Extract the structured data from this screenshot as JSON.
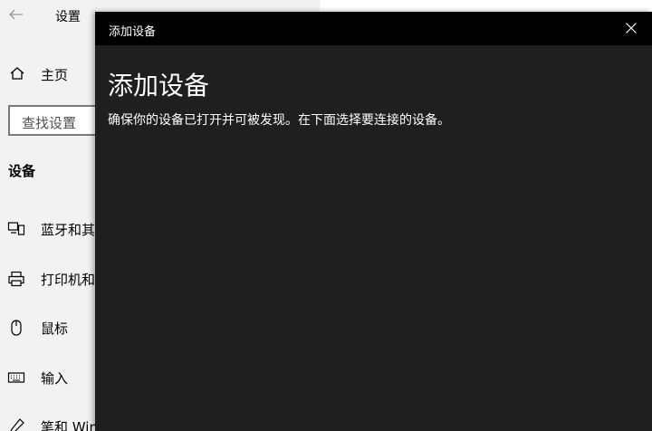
{
  "settings": {
    "title": "设置",
    "home_label": "主页",
    "search_placeholder": "查找设置",
    "section_heading": "设备",
    "nav_items": [
      {
        "label": "蓝牙和其",
        "icon": "bluetooth-devices-icon"
      },
      {
        "label": "打印机和",
        "icon": "printer-icon"
      },
      {
        "label": "鼠标",
        "icon": "mouse-icon"
      },
      {
        "label": "输入",
        "icon": "keyboard-icon"
      },
      {
        "label": "笔和 Win",
        "icon": "pen-icon"
      }
    ]
  },
  "dialog": {
    "titlebar": "添加设备",
    "heading": "添加设备",
    "description": "确保你的设备已打开并可被发现。在下面选择要连接的设备。"
  },
  "colors": {
    "dialog_background": "#1f1f1f",
    "dialog_titlebar": "#000000",
    "settings_sidebar": "#f2f2f2"
  }
}
